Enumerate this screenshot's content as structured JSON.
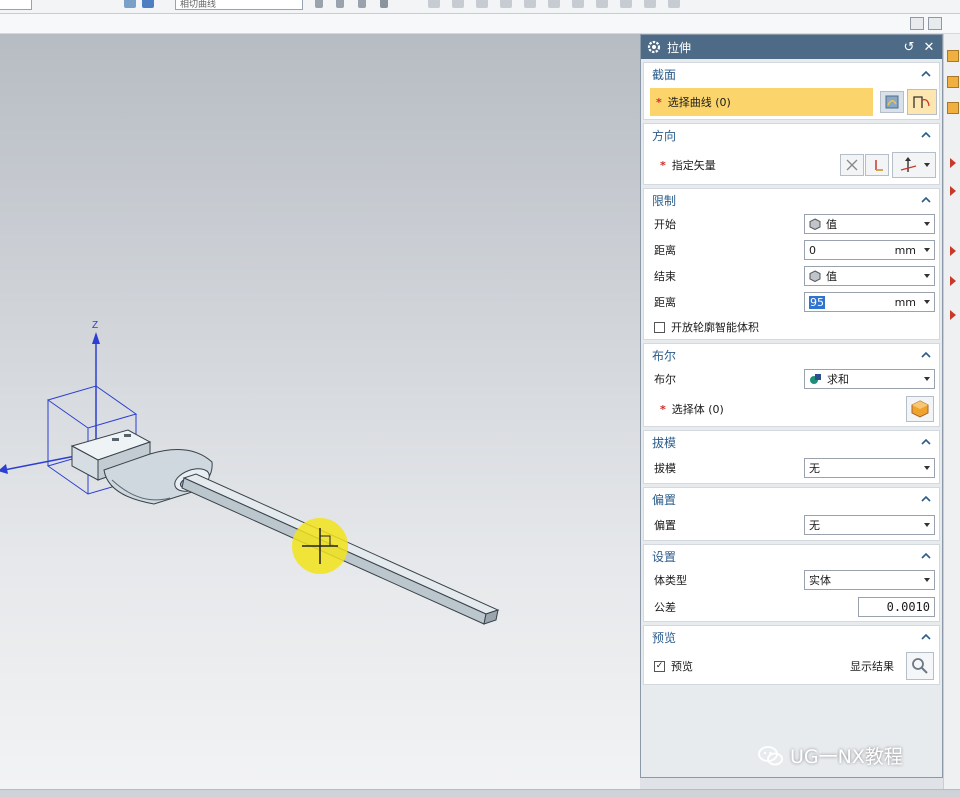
{
  "toolbar": {
    "filter_value": "相切曲线"
  },
  "dialog": {
    "title": "拉伸",
    "sections": {
      "section": {
        "title": "截面",
        "select_curve_label": "选择曲线 (0)"
      },
      "direction": {
        "title": "方向",
        "specify_vector_label": "指定矢量"
      },
      "limits": {
        "title": "限制",
        "start_label": "开始",
        "start_option": "值",
        "start_distance_label": "距离",
        "start_distance_value": "0",
        "start_distance_unit": "mm",
        "end_label": "结束",
        "end_option": "值",
        "end_distance_label": "距离",
        "end_distance_value": "95",
        "end_distance_unit": "mm",
        "open_profile_label": "开放轮廓智能体积"
      },
      "boolean": {
        "title": "布尔",
        "boolean_label": "布尔",
        "boolean_option": "求和",
        "select_body_label": "选择体 (0)"
      },
      "draft": {
        "title": "拔模",
        "draft_label": "拔模",
        "draft_option": "无"
      },
      "offset": {
        "title": "偏置",
        "offset_label": "偏置",
        "offset_option": "无"
      },
      "settings": {
        "title": "设置",
        "body_type_label": "体类型",
        "body_type_option": "实体",
        "tolerance_label": "公差",
        "tolerance_value": "0.0010"
      },
      "preview": {
        "title": "预览",
        "preview_label": "预览",
        "show_result_label": "显示结果"
      }
    }
  },
  "viewport": {
    "axis_z_label": "Z"
  },
  "watermark": {
    "text": "UG一NX教程"
  },
  "colors": {
    "title_bar": "#4d6a86",
    "section_heading": "#2b5d8c",
    "selection_highlight": "#fbd46b",
    "required_star": "#d12b2b"
  }
}
